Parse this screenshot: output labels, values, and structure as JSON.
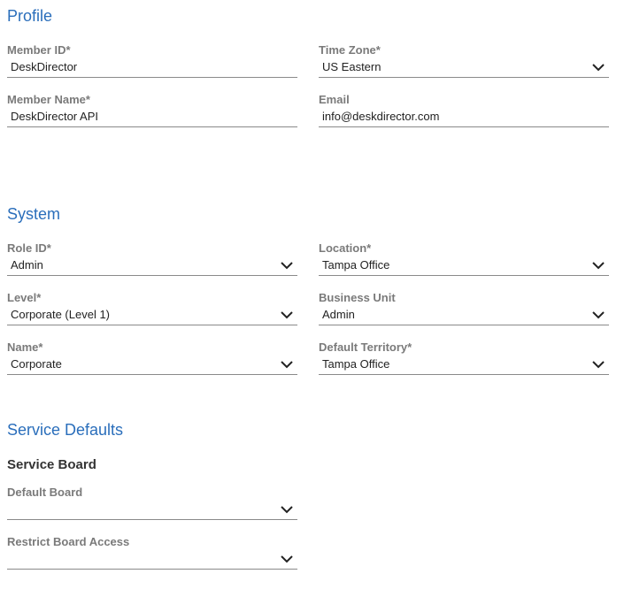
{
  "profile": {
    "title": "Profile",
    "member_id": {
      "label": "Member ID*",
      "value": "DeskDirector"
    },
    "time_zone": {
      "label": "Time Zone*",
      "value": "US Eastern"
    },
    "member_name": {
      "label": "Member Name*",
      "value": "DeskDirector API"
    },
    "email": {
      "label": "Email",
      "value": "info@deskdirector.com"
    }
  },
  "system": {
    "title": "System",
    "role_id": {
      "label": "Role ID*",
      "value": "Admin"
    },
    "location": {
      "label": "Location*",
      "value": "Tampa Office"
    },
    "level": {
      "label": "Level*",
      "value": "Corporate (Level 1)"
    },
    "business_unit": {
      "label": "Business Unit",
      "value": "Admin"
    },
    "name": {
      "label": "Name*",
      "value": "Corporate"
    },
    "default_territory": {
      "label": "Default Territory*",
      "value": "Tampa Office"
    }
  },
  "service_defaults": {
    "title": "Service Defaults",
    "service_board_title": "Service Board",
    "default_board": {
      "label": "Default Board",
      "value": ""
    },
    "restrict_board_access": {
      "label": "Restrict Board Access",
      "value": ""
    }
  },
  "icons": {
    "dropdown": "chevron-down-icon"
  },
  "colors": {
    "section_title": "#2a6ebb",
    "label": "#7a7a7a",
    "underline": "#8a8a8a"
  }
}
